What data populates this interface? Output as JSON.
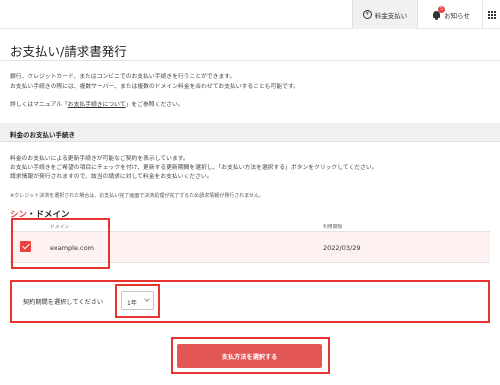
{
  "header": {
    "payment_label": "料金支払い",
    "payment_icon_symbol": "¥",
    "notice_label": "お知らせ",
    "notice_badge": "5",
    "accent_color": "#e8413e"
  },
  "page": {
    "title": "お支払い/請求書発行"
  },
  "intro": {
    "line1": "銀行、クレジットカード、またはコンビニでのお支払い手続きを行うことができます。",
    "line2": "お支払い手続きの際には、複数サーバー、または複数のドメイン料金を合わせてお支払いすることも可能です。",
    "manual_prefix": "詳しくはマニュアル「",
    "manual_link": "お支払手続きについて",
    "manual_suffix": "」をご参照ください。"
  },
  "section": {
    "title": "料金のお支払い手続き",
    "desc1": "料金のお支払いによる更新手続きが可能なご契約を表示しています。",
    "desc2": "お支払い手続きをご希望の項目にチェックを付け、更新する更新期間を選択し、「お支払い方法を選択する」ボタンをクリックしてください。",
    "desc3": "請求情報が発行されますので、該当の請求に対して料金をお支払いください。",
    "note": "※クレジット決済を選択された場合は、お支払い完了画面で決済処理が完了するため請求情報が発行されません。"
  },
  "brand": {
    "part1": "シン",
    "part2": "・ドメイン"
  },
  "table": {
    "col_domain": "ドメイン",
    "col_expiry": "利用期限",
    "rows": [
      {
        "domain": "example.com",
        "expiry": "2022/03/29",
        "checked": true
      }
    ]
  },
  "period": {
    "label": "契約期間を選択してください",
    "selected": "1年"
  },
  "submit_label": "支払方法を選択する"
}
